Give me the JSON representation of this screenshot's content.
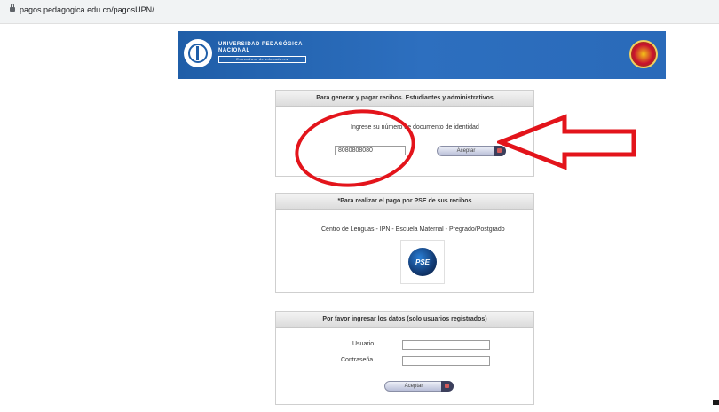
{
  "browser": {
    "url": "pagos.pedagogica.edu.co/pagosUPN/"
  },
  "header": {
    "university_line1": "UNIVERSIDAD PEDAGÓGICA",
    "university_line2": "NACIONAL",
    "tagline": "Educadora de educadores"
  },
  "panel_recibos": {
    "title": "Para generar y pagar recibos. Estudiantes y administrativos",
    "instruction": "Ingrese su número de documento de identidad",
    "document_value": "8080808080",
    "accept_label": "Aceptar"
  },
  "panel_pse": {
    "title": "*Para realizar el pago por PSE de sus recibos",
    "programs": "Centro de Lenguas - IPN - Escuela Maternal - Pregrado/Postgrado",
    "pse_logo_text": "PSE"
  },
  "panel_login": {
    "title": "Por favor ingresar los datos (solo usuarios registrados)",
    "user_label": "Usuario",
    "user_value": "",
    "password_label": "Contraseña",
    "password_value": "",
    "accept_label": "Aceptar"
  },
  "colors": {
    "banner_blue": "#2a6ab9",
    "annotation_red": "#e3141b"
  }
}
